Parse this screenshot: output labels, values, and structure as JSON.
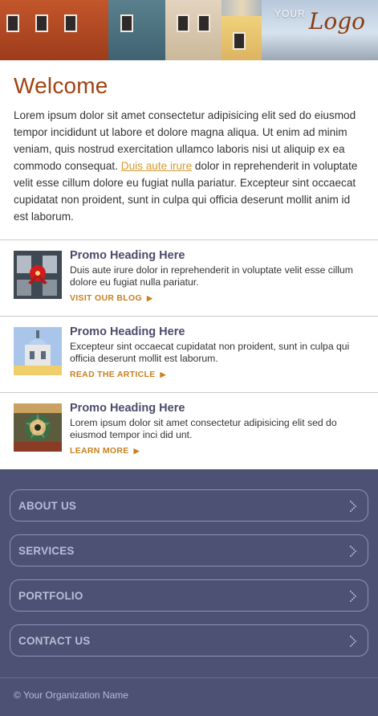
{
  "header": {
    "logo_small": "YOUR",
    "logo_large": "Logo"
  },
  "welcome": {
    "title": "Welcome",
    "body_before_link": "Lorem ipsum dolor sit amet consectetur adipisicing elit sed do eiusmod tempor incididunt ut labore et dolore magna aliqua. Ut enim ad minim veniam, quis nostrud exercitation ullamco laboris nisi ut aliquip ex ea commodo consequat. ",
    "link_text": "Duis aute irure",
    "body_after_link": " dolor in reprehenderit in voluptate velit esse cillum dolore eu fugiat nulla pariatur. Excepteur sint occaecat cupidatat non proident, sunt in culpa qui officia deserunt mollit anim id est laborum."
  },
  "promos": [
    {
      "heading": "Promo Heading Here",
      "description": "Duis aute irure dolor in reprehenderit in voluptate velit esse cillum dolore eu fugiat nulla pariatur.",
      "link": "VISIT OUR BLOG",
      "image_icon": "christmas-window-icon"
    },
    {
      "heading": "Promo Heading Here",
      "description": "Excepteur sint occaecat cupidatat non proident, sunt in culpa qui officia deserunt mollit est laborum.",
      "link": "READ THE ARTICLE",
      "image_icon": "building-dome-icon"
    },
    {
      "heading": "Promo Heading Here",
      "description": "Lorem ipsum dolor sit amet consectetur adipisicing elit sed do eiusmod tempor inci did unt.",
      "link": "LEARN MORE",
      "image_icon": "emblem-sign-icon"
    }
  ],
  "nav": {
    "items": [
      {
        "label": "ABOUT US"
      },
      {
        "label": "SERVICES"
      },
      {
        "label": "PORTFOLIO"
      },
      {
        "label": "CONTACT US"
      }
    ]
  },
  "footer": {
    "copyright": "© Your Organization Name"
  },
  "colors": {
    "accent_orange": "#a04312",
    "link_gold": "#d39a2d",
    "nav_background": "#4d5174",
    "nav_text": "#b8bdd8"
  }
}
